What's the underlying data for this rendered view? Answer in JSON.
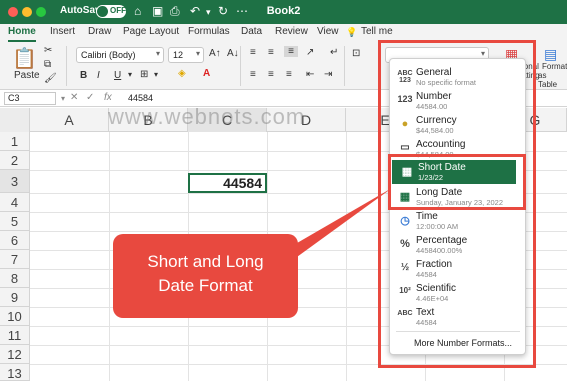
{
  "titlebar": {
    "autosave_label": "AutoSave",
    "toggle_state": "OFF",
    "book_title": "Book2"
  },
  "tabs": [
    {
      "label": "Home",
      "active": true
    },
    {
      "label": "Insert"
    },
    {
      "label": "Draw"
    },
    {
      "label": "Page Layout"
    },
    {
      "label": "Formulas"
    },
    {
      "label": "Data"
    },
    {
      "label": "Review"
    },
    {
      "label": "View"
    },
    {
      "label": "Tell me"
    }
  ],
  "ribbon": {
    "paste_label": "Paste",
    "font_name": "Calibri (Body)",
    "font_size": "12",
    "bold": "B",
    "italic": "I",
    "underline": "U",
    "format_label_right1": "itional",
    "format_label_right2": "atting",
    "format_label_right3": "Format",
    "format_label_right4": "as Table"
  },
  "formula_bar": {
    "name_box": "C3",
    "fx": "fx",
    "value": "44584"
  },
  "grid": {
    "columns": [
      "A",
      "B",
      "C",
      "D",
      "E",
      "F",
      "G"
    ],
    "rows": [
      "1",
      "2",
      "3",
      "4",
      "5",
      "6",
      "7",
      "8",
      "9",
      "10",
      "11",
      "12",
      "13"
    ],
    "active_cell_value": "44584"
  },
  "watermark": "www.webnots.com",
  "callout": {
    "line1": "Short and Long",
    "line2": "Date Format"
  },
  "number_formats": [
    {
      "name": "General",
      "sub": "No specific format",
      "icon": "ABC 123"
    },
    {
      "name": "Number",
      "sub": "44584.00",
      "icon": "123"
    },
    {
      "name": "Currency",
      "sub": "$44,584.00",
      "icon": "coins"
    },
    {
      "name": "Accounting",
      "sub": "$44,584.00",
      "icon": "ledger"
    },
    {
      "name": "Short Date",
      "sub": "1/23/22",
      "icon": "calendar-clock",
      "selected": true
    },
    {
      "name": "Long Date",
      "sub": "Sunday, January 23, 2022",
      "icon": "calendar-clock"
    },
    {
      "name": "Time",
      "sub": "12:00:00 AM",
      "icon": "clock"
    },
    {
      "name": "Percentage",
      "sub": "4458400.00%",
      "icon": "%"
    },
    {
      "name": "Fraction",
      "sub": "44584",
      "icon": "1/2"
    },
    {
      "name": "Scientific",
      "sub": "4.46E+04",
      "icon": "10²"
    },
    {
      "name": "Text",
      "sub": "44584",
      "icon": "ABC"
    }
  ],
  "more_formats": "More Number Formats...",
  "colors": {
    "excel_green": "#1e7145",
    "highlight_red": "#e8493f"
  }
}
